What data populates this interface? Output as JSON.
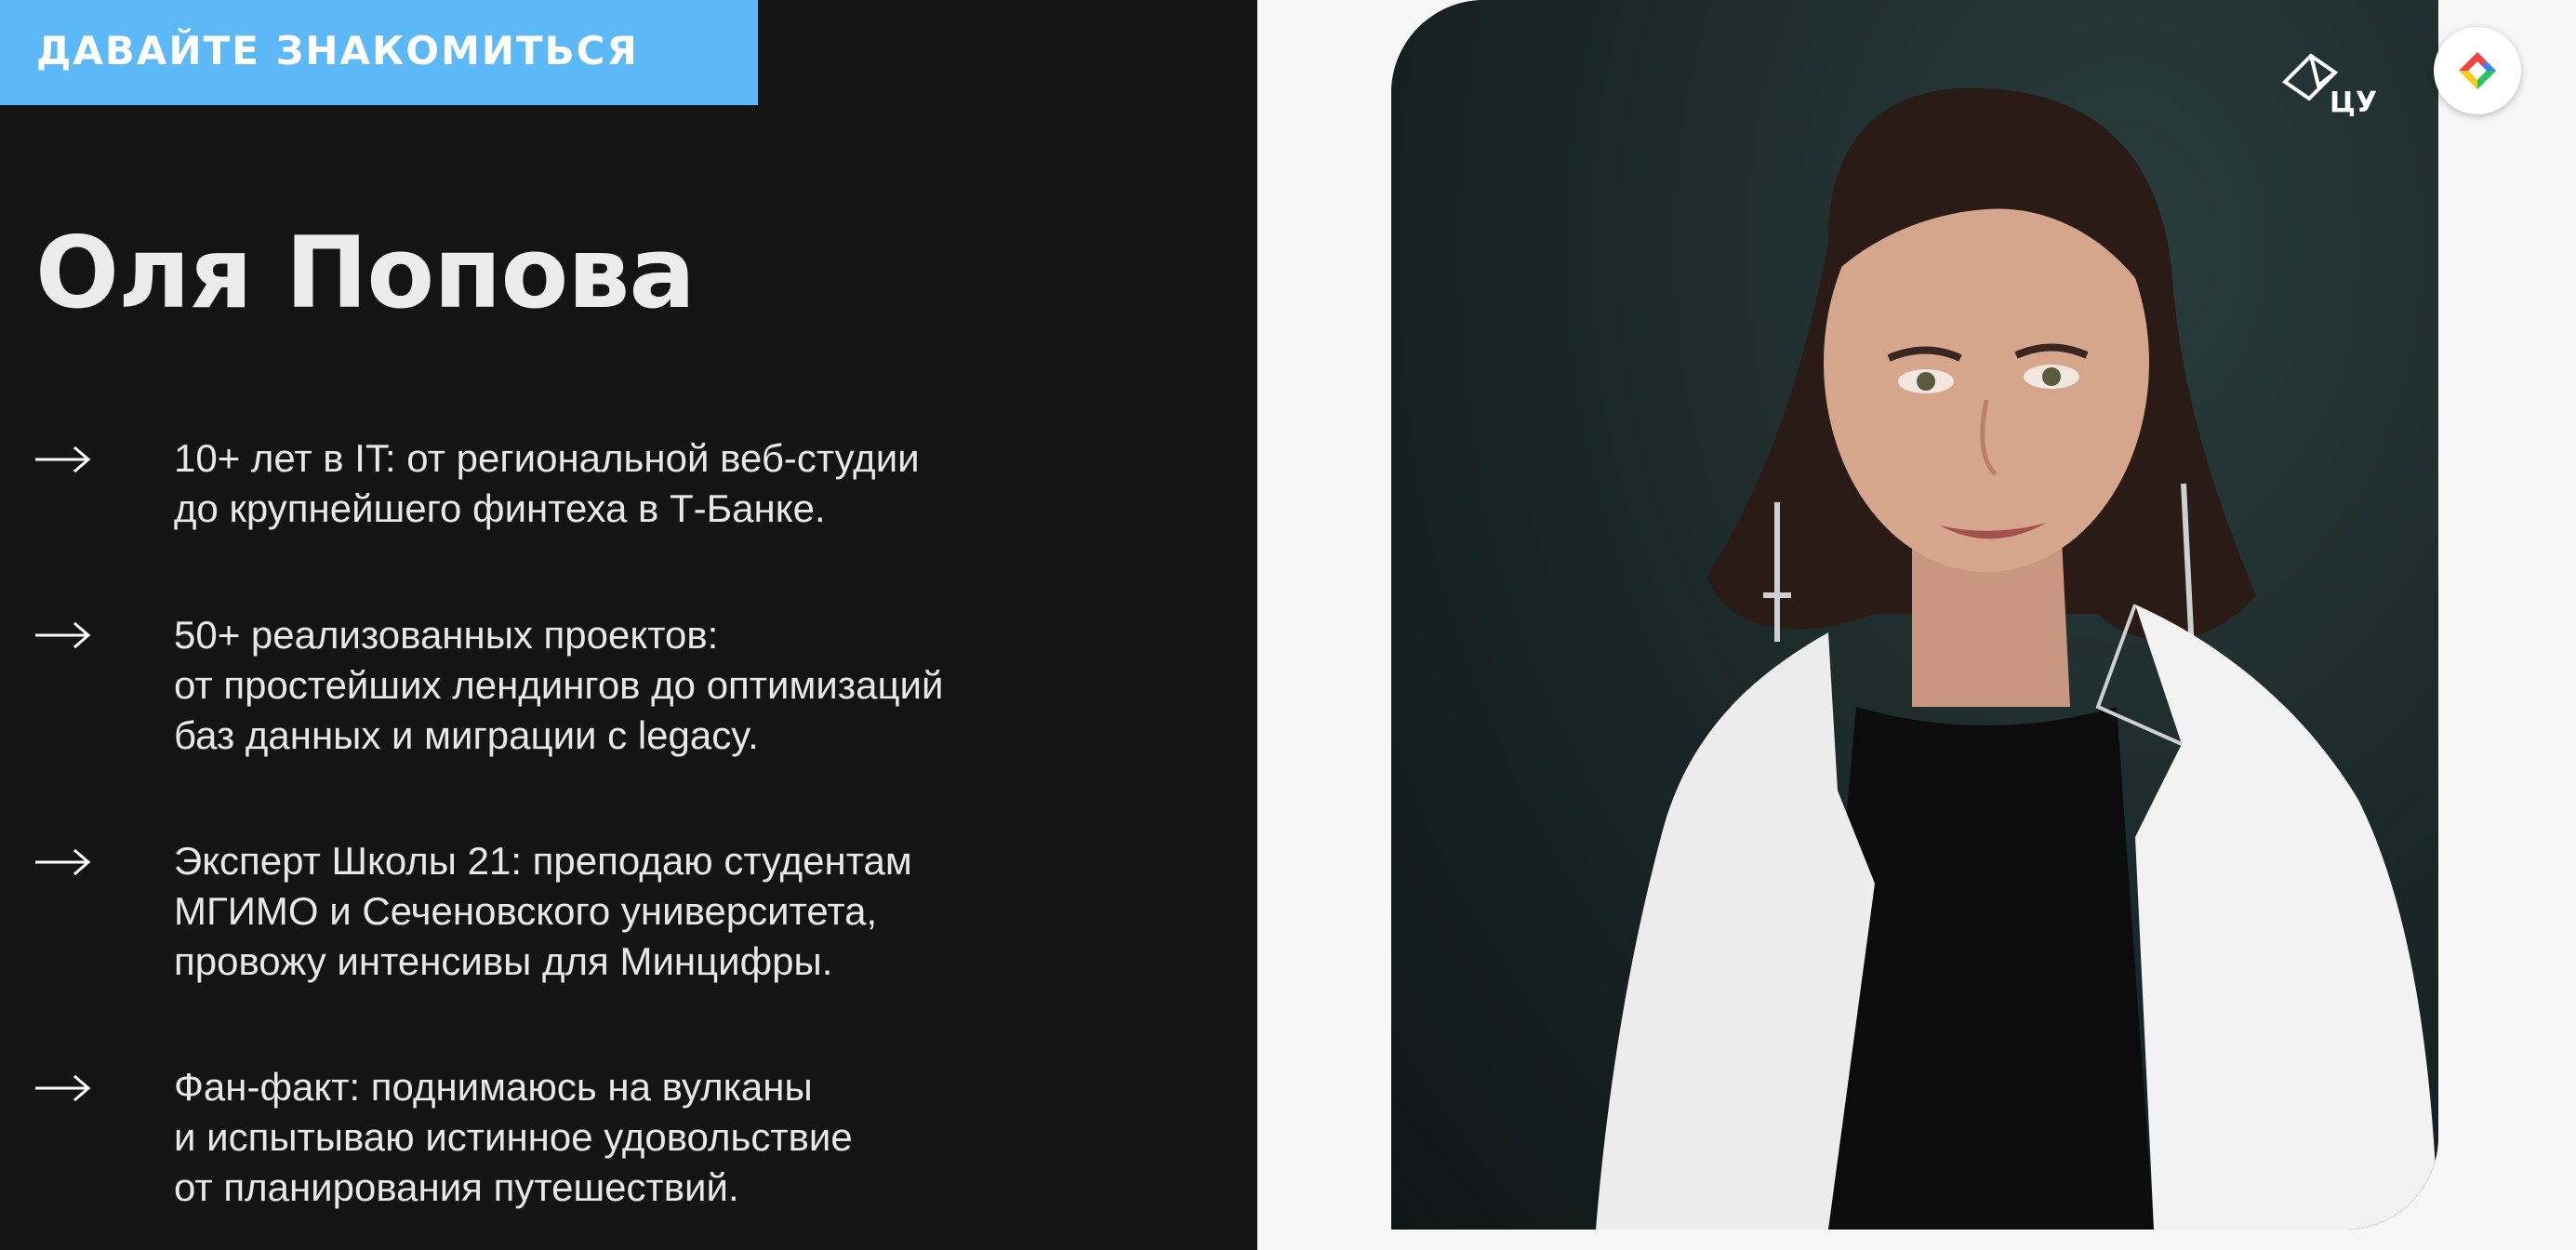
{
  "header": {
    "tag_label": "ДАВАЙТЕ ЗНАКОМИТЬСЯ"
  },
  "speaker": {
    "name": "Оля Попова"
  },
  "bullets": [
    {
      "text": "10+ лет в IT: от региональной веб-студии\nдо крупнейшего финтеха в Т-Банке."
    },
    {
      "text": "50+ реализованных проектов:\nот простейших лендингов до оптимизаций\nбаз данных и миграции с legacy."
    },
    {
      "text": "Эксперт Школы 21: преподаю студентам\nМГИМО и Сеченовского университета,\nпровожу интенсивы для Минцифры."
    },
    {
      "text": "Фан-факт: поднимаюсь на вулканы\nи испытываю истинное удовольствие\nот планирования путешествий."
    }
  ],
  "logo": {
    "text": "ЦУ",
    "icon": "cu-logo-icon"
  },
  "badge": {
    "icon": "app-badge-icon"
  },
  "colors": {
    "accent": "#5cb8f7",
    "left_bg": "#141414",
    "right_bg": "#f7f7f7",
    "text": "#e8e8e8"
  }
}
